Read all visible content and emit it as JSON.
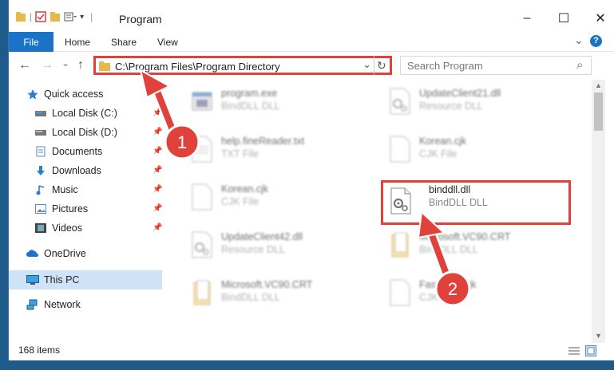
{
  "window": {
    "title": "Program",
    "minimize_glyph": "–",
    "maximize_glyph": "☐",
    "close_glyph": "✕"
  },
  "ribbon": {
    "file": "File",
    "home": "Home",
    "share": "Share",
    "view": "View",
    "expand_glyph": "⌄",
    "help_glyph": "?"
  },
  "nav": {
    "back_glyph": "←",
    "forward_glyph": "→",
    "recent_glyph": "⌄",
    "up_glyph": "↑",
    "address": "C:\\Program Files\\Program Directory",
    "dropdown_glyph": "⌄",
    "refresh_glyph": "↻",
    "search_placeholder": "Search Program",
    "search_icon_glyph": "⌕"
  },
  "sidebar": {
    "items": [
      {
        "label": "Quick access",
        "icon": "star-icon"
      },
      {
        "label": "Local Disk (C:)",
        "icon": "drive-icon"
      },
      {
        "label": "Local Disk (D:)",
        "icon": "drive-icon"
      },
      {
        "label": "Documents",
        "icon": "documents-icon"
      },
      {
        "label": "Downloads",
        "icon": "download-icon"
      },
      {
        "label": "Music",
        "icon": "music-icon"
      },
      {
        "label": "Pictures",
        "icon": "pictures-icon"
      },
      {
        "label": "Videos",
        "icon": "videos-icon"
      },
      {
        "label": "OneDrive",
        "icon": "cloud-icon"
      },
      {
        "label": "This PC",
        "icon": "computer-icon"
      },
      {
        "label": "Network",
        "icon": "network-icon"
      }
    ],
    "pin_glyph": "📌"
  },
  "files": [
    {
      "name": "program.exe",
      "type": "BindDLL DLL"
    },
    {
      "name": "UpdateClient21.dll",
      "type": "Resource DLL"
    },
    {
      "name": "help.fineReader.txt",
      "type": "TXT File"
    },
    {
      "name": "Korean.cjk",
      "type": "CJK File"
    },
    {
      "name": "Korean.cjk",
      "type": "CJK File"
    },
    {
      "name": "binddll.dll",
      "type": "BindDLL DLL"
    },
    {
      "name": "UpdateClient42.dll",
      "type": "Resource DLL"
    },
    {
      "name": "Microsoft.VC90.CRT",
      "type": "BindDLL DLL"
    },
    {
      "name": "Microsoft.VC90.CRT",
      "type": "BindDLL DLL"
    },
    {
      "name": "FastBook.cjk",
      "type": "CJK File"
    }
  ],
  "status": {
    "items_count": "168 items"
  },
  "annotations": {
    "step1": "1",
    "step2": "2"
  },
  "colors": {
    "accent": "#1a73c7",
    "highlight": "#e0413b",
    "selected_nav": "#cfe3f7"
  }
}
